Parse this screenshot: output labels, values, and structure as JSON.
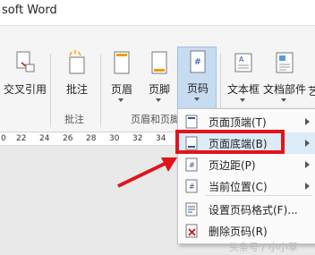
{
  "window": {
    "title": "soft Word"
  },
  "ribbon": {
    "buttons": [
      {
        "label": "交叉引用",
        "icon": "cross-reference-icon"
      },
      {
        "label": "批注",
        "icon": "comment-icon"
      },
      {
        "label": "页眉",
        "icon": "header-icon"
      },
      {
        "label": "页脚",
        "icon": "footer-icon"
      },
      {
        "label": "页码",
        "icon": "page-number-icon"
      },
      {
        "label": "文本框",
        "icon": "text-box-icon"
      },
      {
        "label": "文档部件",
        "icon": "quick-parts-icon"
      },
      {
        "label": "艺"
      }
    ],
    "groups": {
      "comments": "批注",
      "header_footer": "页眉和页脚"
    }
  },
  "ruler": {
    "ticks": [
      "0",
      "22",
      "24",
      "26",
      "28",
      "30",
      "32",
      "34"
    ]
  },
  "page_number_menu": {
    "items": [
      {
        "label": "页面顶端(T)",
        "icon": "page-top-icon",
        "submenu": true
      },
      {
        "label": "页面底端(B)",
        "icon": "page-bottom-icon",
        "submenu": true
      },
      {
        "label": "页边距(P)",
        "icon": "page-margin-icon",
        "submenu": true
      },
      {
        "label": "当前位置(C)",
        "icon": "current-position-icon",
        "submenu": true
      },
      {
        "label": "设置页码格式(F)...",
        "icon": "format-page-number-icon",
        "submenu": false
      },
      {
        "label": "删除页码(R)",
        "icon": "remove-page-number-icon",
        "submenu": false
      }
    ]
  },
  "annotation": {
    "color": "#e1141c"
  },
  "watermark": "头条号 / 小小草"
}
